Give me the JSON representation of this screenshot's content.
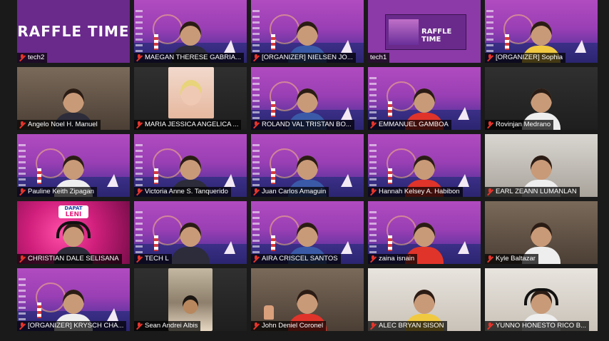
{
  "participants": [
    {
      "name": "tech2",
      "muted": true,
      "bg": "raffle",
      "slide_title": "RAFFLE TIME"
    },
    {
      "name": "MAEGAN THERESE GABRIA...",
      "muted": true,
      "bg": "purple",
      "active": true
    },
    {
      "name": "[ORGANIZER] NIELSEN JO...",
      "muted": true,
      "bg": "purple"
    },
    {
      "name": "tech1",
      "muted": false,
      "bg": "share",
      "slide_title": "RAFFLE TIME"
    },
    {
      "name": "[ORGANIZER] Sophia",
      "muted": true,
      "bg": "purple"
    },
    {
      "name": "Angelo Noel H. Manuel",
      "muted": true,
      "bg": "room"
    },
    {
      "name": "MARIA JESSICA ANGELICA ...",
      "muted": true,
      "bg": "still"
    },
    {
      "name": "ROLAND VAL TRISTAN BO...",
      "muted": true,
      "bg": "purple"
    },
    {
      "name": "EMMANUEL GAMBOA",
      "muted": true,
      "bg": "purple"
    },
    {
      "name": "Rovinjan Medrano",
      "muted": true,
      "bg": "dark"
    },
    {
      "name": "Pauline Keith Zipagan",
      "muted": true,
      "bg": "purple"
    },
    {
      "name": "Victoria Anne S. Tanquerido",
      "muted": true,
      "bg": "purple"
    },
    {
      "name": "Juan Carlos Amaguin",
      "muted": true,
      "bg": "purple"
    },
    {
      "name": "Hannah Kelsey A. Habibon",
      "muted": true,
      "bg": "purple"
    },
    {
      "name": "EARL ZEANN LUMANLAN",
      "muted": true,
      "bg": "light"
    },
    {
      "name": "CHRISTIAN DALE SELISANA",
      "muted": true,
      "bg": "neon",
      "logo_top": "DAPAT",
      "logo_bottom": "LENI"
    },
    {
      "name": "TECH L",
      "muted": true,
      "bg": "purple"
    },
    {
      "name": "AIRA CRISCEL SANTOS",
      "muted": true,
      "bg": "purple"
    },
    {
      "name": "zaina isnain",
      "muted": true,
      "bg": "purple"
    },
    {
      "name": "Kyle Baltazar",
      "muted": true,
      "bg": "room"
    },
    {
      "name": "[ORGANIZER] KRYSCH CHA...",
      "muted": true,
      "bg": "purple"
    },
    {
      "name": "Sean Andrei Albis",
      "muted": true,
      "bg": "still-small"
    },
    {
      "name": "John Deniel Coronel",
      "muted": true,
      "bg": "room"
    },
    {
      "name": "ALEC BRYAN SISON",
      "muted": true,
      "bg": "wall"
    },
    {
      "name": "YUNNO HONESTO RICO B...",
      "muted": true,
      "bg": "wall"
    }
  ],
  "colors": {
    "active_outline": "#e7e24a",
    "muted_icon": "#e5342b"
  },
  "icons": {
    "muted": "mic-muted-icon"
  }
}
